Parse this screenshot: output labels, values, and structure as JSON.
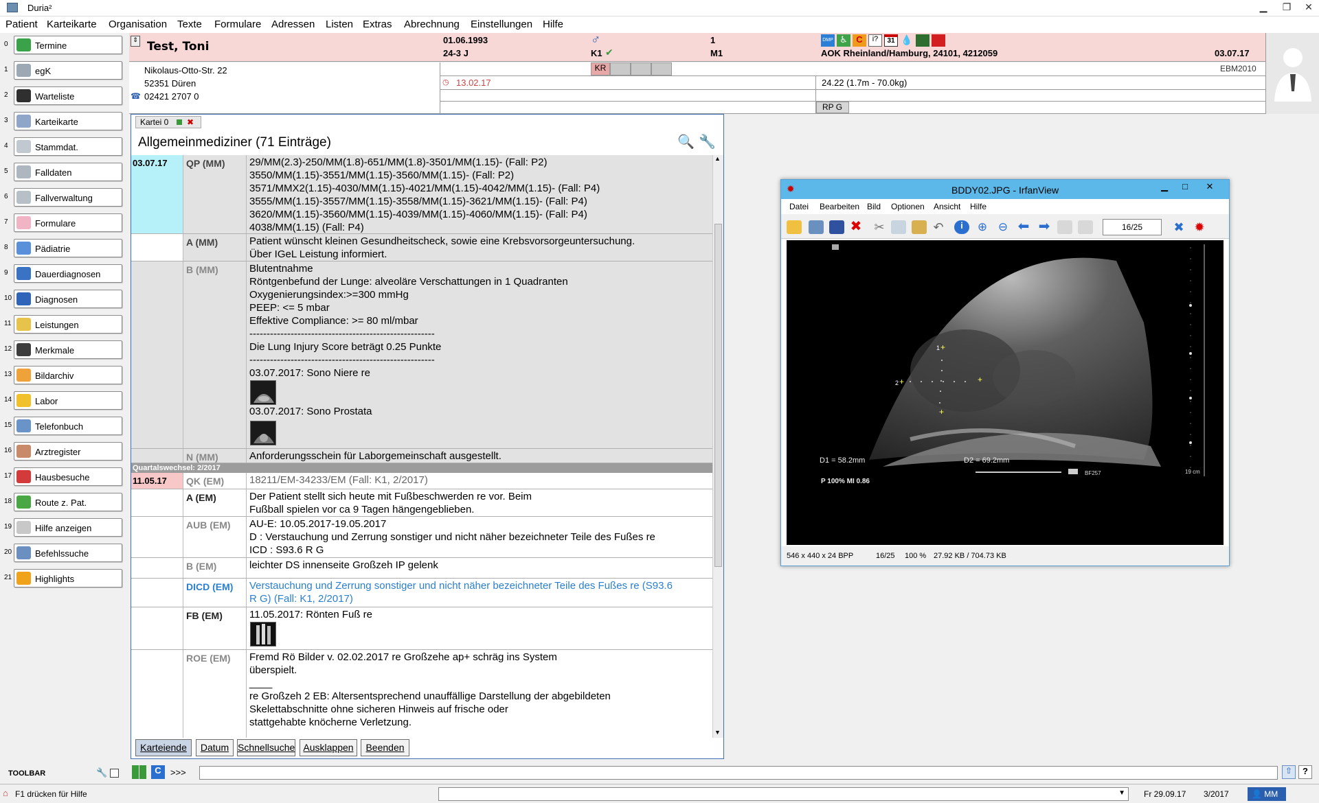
{
  "app": {
    "title": "Duria²"
  },
  "menu": [
    "Patient",
    "Karteikarte",
    "Organisation",
    "Texte",
    "Formulare",
    "Adressen",
    "Listen",
    "Extras",
    "Abrechnung",
    "Einstellungen",
    "Hilfe"
  ],
  "sidebar": [
    {
      "num": "0",
      "label": "Termine",
      "color": "#3aa34a"
    },
    {
      "num": "1",
      "label": "egK",
      "color": "#9ca8b4"
    },
    {
      "num": "2",
      "label": "Warteliste",
      "color": "#2f2f2f"
    },
    {
      "num": "3",
      "label": "Karteikarte",
      "color": "#8fa6c9"
    },
    {
      "num": "4",
      "label": "Stammdat.",
      "color": "#c2c8cf"
    },
    {
      "num": "5",
      "label": "Falldaten",
      "color": "#aeb7c0"
    },
    {
      "num": "6",
      "label": "Fallverwaltung",
      "color": "#b7bfc7"
    },
    {
      "num": "7",
      "label": "Formulare",
      "color": "#f1b4c4"
    },
    {
      "num": "8",
      "label": "Pädiatrie",
      "color": "#5a8fd9"
    },
    {
      "num": "9",
      "label": "Dauerdiagnosen",
      "color": "#3a73c4"
    },
    {
      "num": "10",
      "label": "Diagnosen",
      "color": "#2f64b8"
    },
    {
      "num": "11",
      "label": "Leistungen",
      "color": "#e7c34b"
    },
    {
      "num": "12",
      "label": "Merkmale",
      "color": "#3d3d3d"
    },
    {
      "num": "13",
      "label": "Bildarchiv",
      "color": "#f0a23a"
    },
    {
      "num": "14",
      "label": "Labor",
      "color": "#f0c12a"
    },
    {
      "num": "15",
      "label": "Telefonbuch",
      "color": "#6a93c8"
    },
    {
      "num": "16",
      "label": "Arztregister",
      "color": "#c98a6a"
    },
    {
      "num": "17",
      "label": "Hausbesuche",
      "color": "#d33a3a"
    },
    {
      "num": "18",
      "label": "Route z. Pat.",
      "color": "#4aa844"
    },
    {
      "num": "19",
      "label": "Hilfe anzeigen",
      "color": "#c8c8c8"
    },
    {
      "num": "20",
      "label": "Befehlssuche",
      "color": "#6a8fc0"
    },
    {
      "num": "21",
      "label": "Highlights",
      "color": "#f0a21a"
    }
  ],
  "patient": {
    "name": "Test, Toni",
    "dob": "01.06.1993",
    "age": "24-3 J",
    "gender_icon": "male-icon",
    "k1": "K1",
    "num1": "1",
    "m1": "M1",
    "insurance": "AOK Rheinland/Hamburg, 24101, 4212059",
    "date_right": "03.07.17",
    "ebm": "EBM2010",
    "street": "Nikolaus-Otto-Str. 22",
    "city": "52351 Düren",
    "phone": "02421 2707 0",
    "kr": "KR",
    "date_small": "13.02.17",
    "bmi": "24.22   (1.7m - 70.0kg)",
    "rpg": "RP G"
  },
  "kartei": {
    "tab": "Kartei 0",
    "caption": "Allgemeinmediziner  (71 Einträge)",
    "entries": [
      {
        "date": "03.07.17",
        "code": "QP (MM)",
        "text": "29/MM(2.3)-250/MM(1.8)-651/MM(1.8)-3501/MM(1.15)- (Fall: P2)\n3550/MM(1.15)-3551/MM(1.15)-3560/MM(1.15)- (Fall: P2)\n3571/MMX2(1.15)-4030/MM(1.15)-4021/MM(1.15)-4042/MM(1.15)- (Fall: P4)\n3555/MM(1.15)-3557/MM(1.15)-3558/MM(1.15)-3621/MM(1.15)- (Fall: P4)\n3620/MM(1.15)-3560/MM(1.15)-4039/MM(1.15)-4060/MM(1.15)- (Fall: P4)\n4038/MM(1.15) (Fall: P4)"
      },
      {
        "date": "",
        "code": "A (MM)",
        "text": "Patient wünscht kleinen Gesundheitscheck, sowie eine Krebsvorsorgeuntersuchung.\nÜber IGeL Leistung informiert."
      },
      {
        "date": "",
        "code": "B (MM)",
        "text": "Blutentnahme\nRöntgenbefund der Lunge: alveoläre Verschattungen in 1 Quadranten\nOxygenierungsindex:>=300 mmHg\nPEEP: <= 5 mbar\nEffektive Compliance: >= 80 ml/mbar\n------------------------------------------------------\nDie Lung Injury Score beträgt 0.25 Punkte\n------------------------------------------------------\n03.07.2017: Sono Niere re"
      },
      {
        "date": "",
        "code": "N (MM)",
        "text": "Anforderungsschein für Laborgemeinschaft ausgestellt."
      },
      {
        "date": "11.05.17",
        "code": "QK (EM)",
        "text": "18211/EM-34233/EM (Fall: K1, 2/2017)"
      },
      {
        "date": "",
        "code": "A (EM)",
        "text": "Der Patient stellt sich heute mit Fußbeschwerden re vor. Beim\nFußball spielen vor ca 9 Tagen hängengeblieben."
      },
      {
        "date": "",
        "code": "AUB (EM)",
        "text": "AU-E: 10.05.2017-19.05.2017\nD   : Verstauchung und Zerrung sonstiger und nicht näher bezeichneter Teile des Fußes re\nICD : S93.6 R G"
      },
      {
        "date": "",
        "code": "B (EM)",
        "text": "leichter DS innenseite Großzeh IP gelenk"
      },
      {
        "date": "",
        "code": "DICD (EM)",
        "text": "Verstauchung und Zerrung sonstiger und nicht näher bezeichneter Teile des Fußes re (S93.6\nR G) (Fall: K1, 2/2017)"
      },
      {
        "date": "",
        "code": "FB (EM)",
        "text": "11.05.2017: Rönten Fuß re"
      },
      {
        "date": "",
        "code": "ROE (EM)",
        "text": "Fremd Rö Bilder v. 02.02.2017 re Großzehe ap+ schräg ins System\nüberspielt.\n____\nre Großzeh 2 EB: Altersentsprechend unauffällige Darstellung der abgebildeten\nSkelettabschnitte ohne sicheren Hinweis auf frische oder\nstattgehabte knöcherne Verletzung."
      }
    ],
    "sono_prostata": "03.07.2017: Sono Prostata",
    "quartal_divider": "Quartalswechsel: 2/2017",
    "buttons": [
      "Karteiende",
      "Datum",
      "Schnellsuche",
      "Ausklappen",
      "Beenden"
    ]
  },
  "irfanview": {
    "title": "BDDY02.JPG - IrfanView",
    "menu": [
      "Datei",
      "Bearbeiten",
      "Bild",
      "Optionen",
      "Ansicht",
      "Hilfe"
    ],
    "page": "16/25",
    "d1": "D1 = 58.2mm",
    "d2": "D2 = 69.2mm",
    "p": "P 100%   MI 0.86",
    "depth": "19 cm",
    "bf": "BF257",
    "status": [
      "546 x 440 x 24 BPP",
      "16/25",
      "100 %",
      "27.92 KB / 704.73 KB"
    ]
  },
  "bottom": {
    "toolbar": "TOOLBAR",
    "prompt": ">>>",
    "help": "F1 drücken für Hilfe",
    "date": "Fr 29.09.17",
    "quarter": "3/2017",
    "user": "MM"
  }
}
